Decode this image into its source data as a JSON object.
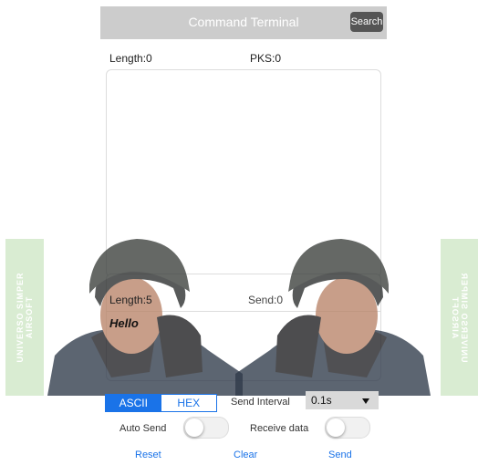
{
  "header": {
    "title": "Command Terminal",
    "search_label": "Search"
  },
  "receive": {
    "length_label": "Length:0",
    "pks_label": "PKS:0"
  },
  "send": {
    "length_label": "Length:5",
    "send_count_label": "Send:0",
    "text": "Hello"
  },
  "controls": {
    "ascii_label": "ASCII",
    "hex_label": "HEX",
    "selected_mode": "ASCII",
    "interval_label": "Send Interval",
    "interval_value": "0.1s",
    "auto_send_label": "Auto Send",
    "auto_send_on": false,
    "receive_data_label": "Receive data",
    "receive_data_on": false
  },
  "actions": {
    "reset": "Reset",
    "clear": "Clear",
    "send": "Send"
  },
  "watermark": {
    "line1": "UNIVERSO SIMPER",
    "line2": "AIRSOFT"
  },
  "colors": {
    "accent": "#1a73e8",
    "header_bg": "#cccccc",
    "watermark_bg": "#d9ecd2"
  }
}
